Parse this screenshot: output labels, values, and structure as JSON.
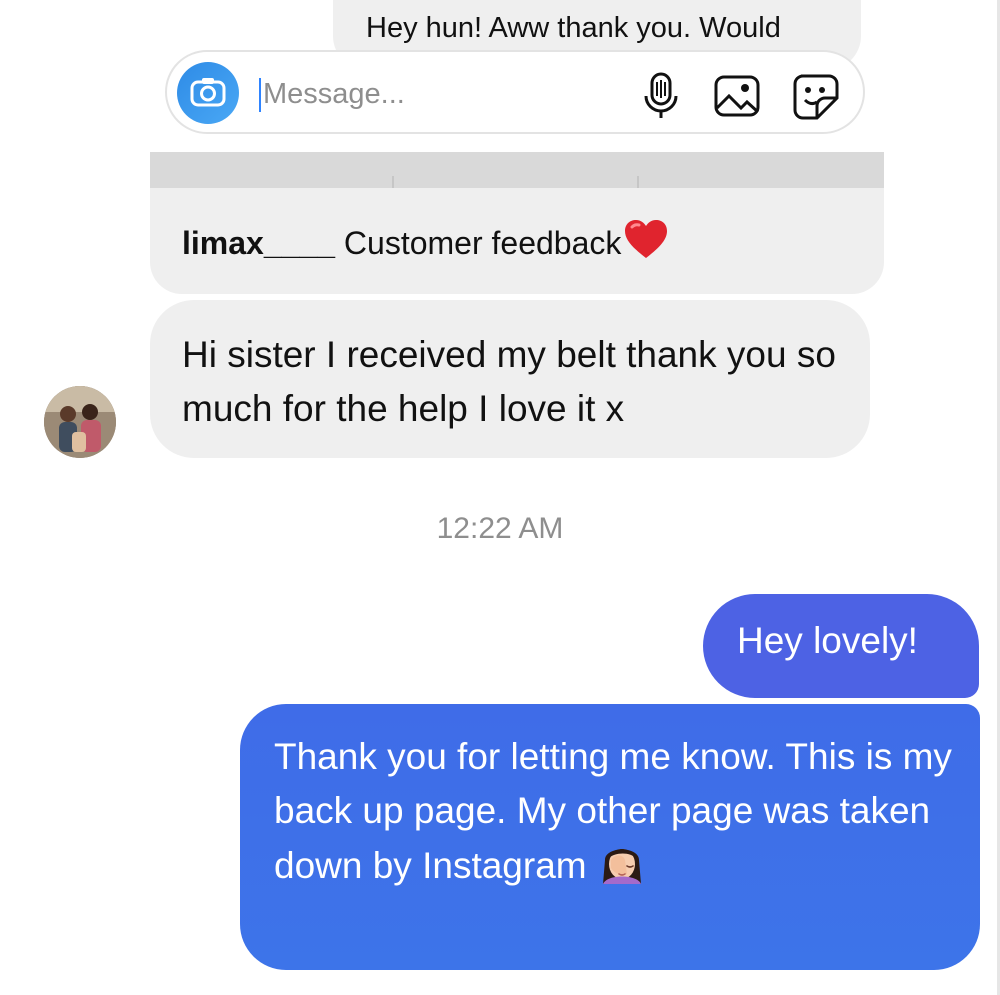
{
  "thread": {
    "top_partial_message": "Hey hun! Aww thank you. Would",
    "composer": {
      "placeholder": "Message...",
      "icons": [
        "camera-icon",
        "microphone-icon",
        "image-icon",
        "sticker-icon"
      ]
    },
    "reply_card": {
      "username": "limax____",
      "caption": "Customer feedback",
      "emoji": "red-heart"
    },
    "incoming_message": {
      "avatar": "contact-avatar",
      "text": "Hi sister I received my belt thank you so much for the help I love it x"
    },
    "timestamp": "12:22 AM",
    "outgoing_messages": [
      {
        "text": "Hey lovely!"
      },
      {
        "text": "Thank you for letting me know. This is my back up page. My other page was taken down by Instagram",
        "emoji": "woman-facepalming"
      }
    ]
  },
  "colors": {
    "incoming_bubble": "#efefef",
    "outgoing_bubble": "#4d62e4",
    "outgoing_bubble_2": "#3f6ce8",
    "camera_button": "#2e8be6",
    "timestamp": "#8e8e8e"
  }
}
